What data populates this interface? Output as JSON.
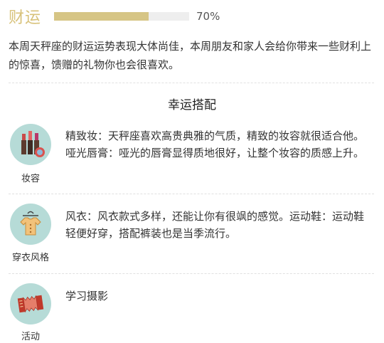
{
  "wealth": {
    "title": "财运",
    "progress": 0.7,
    "percent_label": "70%",
    "description": "本周天秤座的财运运势表现大体尚佳，本周朋友和家人会给你带来一些财利上的惊喜，馈赠的礼物你也会很喜欢。"
  },
  "lucky": {
    "title": "幸运搭配",
    "items": [
      {
        "icon": "makeup-icon",
        "label": "妆容",
        "text": "精致妆：天秤座喜欢高贵典雅的气质，精致的妆容就很适合他。哑光唇膏：哑光的唇膏显得质地很好，让整个妆容的质感上升。"
      },
      {
        "icon": "clothing-icon",
        "label": "穿衣风格",
        "text": "风衣：风衣款式多样，还能让你有很飒的感觉。运动鞋：运动鞋轻便好穿，搭配裤装也是当季流行。"
      },
      {
        "icon": "accordion-icon",
        "label": "活动",
        "text": "学习摄影"
      }
    ]
  },
  "colors": {
    "accent": "#d6c585",
    "title": "#d8c27a",
    "icon_bg": "#b6dbd7"
  }
}
